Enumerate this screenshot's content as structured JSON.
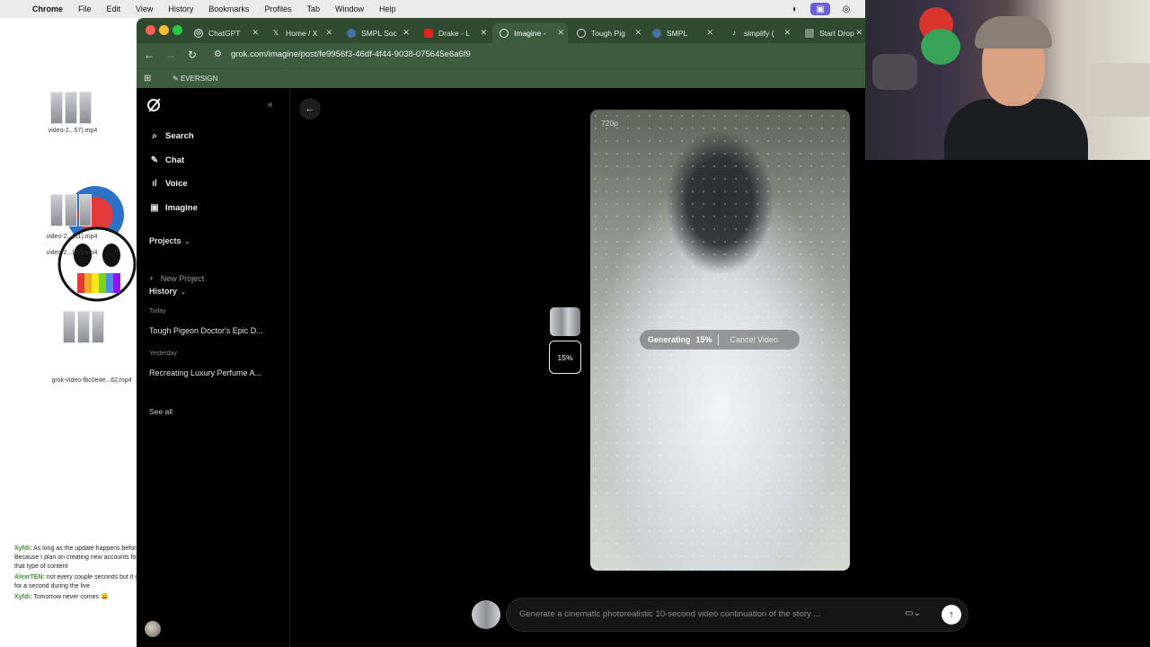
{
  "menubar": {
    "app": "Chrome",
    "items": [
      "File",
      "Edit",
      "View",
      "History",
      "Bookmarks",
      "Profiles",
      "Tab",
      "Window",
      "Help"
    ]
  },
  "desktop": {
    "files": [
      {
        "label": "video-2...57).mp4"
      },
      {
        "label": "video-2...(31).mp4"
      },
      {
        "label": "video-2...(30).mp4"
      },
      {
        "label": "grok-video-fbc0e4e...62.mp4"
      }
    ],
    "chat": [
      {
        "user": "Xyfdi:",
        "text": "As long as the update happens before Friday that would be good. Because I plan on creating new accounts for a character and start posting that type of content"
      },
      {
        "user": "AlexrTEN:",
        "text": "not every couple seconds but it does happen every now and then for a second during the live"
      },
      {
        "user": "Xyfdi:",
        "text": "Tomorrow never comes"
      }
    ]
  },
  "browser": {
    "tabs": [
      {
        "label": "ChatGPT",
        "icon": "openai-icon"
      },
      {
        "label": "Home / X",
        "icon": "x-icon"
      },
      {
        "label": "SMPL Soc",
        "icon": "smpl-icon"
      },
      {
        "label": "Drake - L",
        "icon": "youtube-icon"
      },
      {
        "label": "Imagine -",
        "icon": "grok-icon",
        "active": true
      },
      {
        "label": "Tough Pig",
        "icon": "grok-icon"
      },
      {
        "label": "SMPL",
        "icon": "smpl-icon"
      },
      {
        "label": "simplify (",
        "icon": "tiktok-icon"
      },
      {
        "label": "Start Drop",
        "icon": "page-icon"
      }
    ],
    "url": "grok.com/imagine/post/fe9956f3-46df-4f44-9038-075645e6a6f9",
    "bookmarks": [
      "EVERSIGN"
    ]
  },
  "sidebar": {
    "nav": [
      {
        "label": "Search",
        "icon": "search-icon"
      },
      {
        "label": "Chat",
        "icon": "chat-icon"
      },
      {
        "label": "Voice",
        "icon": "voice-icon"
      },
      {
        "label": "Imagine",
        "icon": "image-icon"
      }
    ],
    "projects_label": "Projects",
    "new_project": "New Project",
    "history_label": "History",
    "today_label": "Today",
    "today_items": [
      "Tough Pigeon Doctor's Epic D..."
    ],
    "yesterday_label": "Yesterday",
    "yesterday_items": [
      "Recreating Luxury Perfume A..."
    ],
    "see_all": "See all"
  },
  "main": {
    "resolution": "720p",
    "thumb_progress": "15%",
    "generating_label": "Generating",
    "generating_percent": "15%",
    "progress": 0.15,
    "cancel_label": "Cancel Video",
    "actions": [
      "heart-icon",
      "x-share-icon",
      "remix-icon",
      "download-icon",
      "upload-icon",
      "more-icon"
    ]
  },
  "prompt": {
    "placeholder": "Generate a cinematic photorealistic 10-second video continuation of the story ..."
  },
  "colors": {
    "tab_bg": "#2f4a2f",
    "toolbar_bg": "#3d5b3d",
    "page_bg": "#000000",
    "heart": "#e8325a",
    "menubar_pill": "#6c5cd6"
  }
}
